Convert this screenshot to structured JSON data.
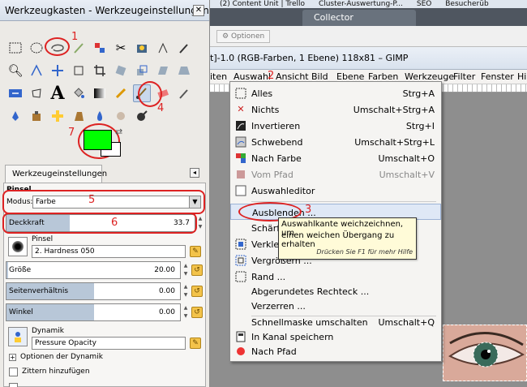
{
  "toolbox": {
    "title": "Werkzeugkasten - Werkzeugeinstellungen",
    "tab_label": "Werkzeugeinstellungen",
    "tool_name": "Pinsel",
    "mode_label": "Modus:",
    "mode_value": "Farbe",
    "opacity_label": "Deckkraft",
    "opacity_value": "33.7",
    "opacity_fraction": 0.337,
    "brush_label": "Pinsel",
    "brush_value": "2. Hardness 050",
    "size_label": "Größe",
    "size_value": "20.00",
    "aspect_label": "Seitenverhältnis",
    "aspect_value": "0.00",
    "angle_label": "Winkel",
    "angle_value": "0.00",
    "dynamics_label": "Dynamik",
    "dynamics_value": "Pressure Opacity",
    "dynamics_options_label": "Optionen der Dynamik",
    "jitter_label": "Zittern hinzufügen",
    "fg_color": "#00ff00",
    "bg_color": "#ffffff"
  },
  "annotations": {
    "n1": "1",
    "n2": "2",
    "n3": "3",
    "n4": "4",
    "n5": "5",
    "n6": "6",
    "n7": "7"
  },
  "browser": {
    "bookmarks": [
      "(2) Content Unit | Trello",
      "Cluster-Auswertung-P...",
      "SEO",
      "Besucherüb"
    ],
    "active_tab": "Collector",
    "options_button": "Optionen"
  },
  "image_window": {
    "title": "t]-1.0 (RGB-Farben, 1 Ebene) 118x81 – GIMP",
    "menus": [
      "iten",
      "Auswahl",
      "Ansicht",
      "Bild",
      "Ebene",
      "Farben",
      "Werkzeuge",
      "Filter",
      "Fenster",
      "Hil"
    ]
  },
  "selection_menu": {
    "items": [
      {
        "label": "Alles",
        "shortcut": "Strg+A",
        "icon": "select-all-icon"
      },
      {
        "label": "Nichts",
        "shortcut": "Umschalt+Strg+A",
        "icon": "select-none-icon"
      },
      {
        "label": "Invertieren",
        "shortcut": "Strg+I",
        "icon": "invert-icon"
      },
      {
        "label": "Schwebend",
        "shortcut": "Umschalt+Strg+L",
        "icon": "float-icon"
      },
      {
        "label": "Nach Farbe",
        "shortcut": "Umschalt+O",
        "icon": "by-color-icon"
      },
      {
        "label": "Vom Pfad",
        "shortcut": "Umschalt+V",
        "icon": "from-path-icon"
      },
      {
        "label": "Auswahleditor",
        "shortcut": "",
        "icon": "selection-editor-icon"
      },
      {
        "label": "Ausblenden ...",
        "shortcut": "",
        "icon": ""
      },
      {
        "label": "Schärfe",
        "shortcut": "",
        "icon": ""
      },
      {
        "label": "Verklein",
        "shortcut": "",
        "icon": "shrink-icon"
      },
      {
        "label": "Vergrößern ...",
        "shortcut": "",
        "icon": "grow-icon"
      },
      {
        "label": "Rand ...",
        "shortcut": "",
        "icon": "border-icon"
      },
      {
        "label": "Abgerundetes Rechteck ...",
        "shortcut": "",
        "icon": ""
      },
      {
        "label": "Verzerren ...",
        "shortcut": "",
        "icon": ""
      },
      {
        "label": "Schnellmaske umschalten",
        "shortcut": "Umschalt+Q",
        "icon": ""
      },
      {
        "label": "In Kanal speichern",
        "shortcut": "",
        "icon": "save-channel-icon"
      },
      {
        "label": "Nach Pfad",
        "shortcut": "",
        "icon": "to-path-icon"
      }
    ],
    "tooltip": {
      "line1": "Auswahlkante weichzeichnen, um",
      "line2": "einen weichen Übergang zu erhalten",
      "hint": "Drücken Sie F1 für mehr Hilfe"
    }
  }
}
